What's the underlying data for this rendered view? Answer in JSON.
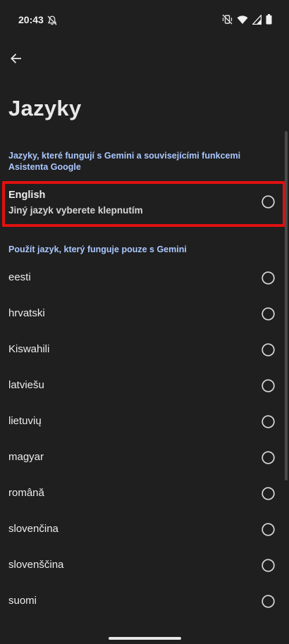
{
  "status_bar": {
    "time": "20:43",
    "icons": [
      "bell-off-icon",
      "vibrate-off-icon",
      "wifi-icon",
      "signal-icon",
      "battery-icon"
    ]
  },
  "header": {
    "back_icon": "arrow-back-icon",
    "title": "Jazyky"
  },
  "sections": {
    "assistant_header": "Jazyky, které fungují s Gemini a souvisejícími funkcemi Asistenta Google",
    "primary_item": {
      "title": "English",
      "subtitle": "Jiný jazyk vyberete klepnutím",
      "selected": false
    },
    "gemini_only_header": "Použít jazyk, který funguje pouze s Gemini"
  },
  "languages": [
    {
      "label": "eesti"
    },
    {
      "label": "hrvatski"
    },
    {
      "label": "Kiswahili"
    },
    {
      "label": "latviešu"
    },
    {
      "label": "lietuvių"
    },
    {
      "label": "magyar"
    },
    {
      "label": "română"
    },
    {
      "label": "slovenčina"
    },
    {
      "label": "slovenščina"
    },
    {
      "label": "suomi"
    }
  ],
  "colors": {
    "background": "#1f1f1f",
    "section_header": "#aac7ff",
    "highlight": "#e01010"
  }
}
